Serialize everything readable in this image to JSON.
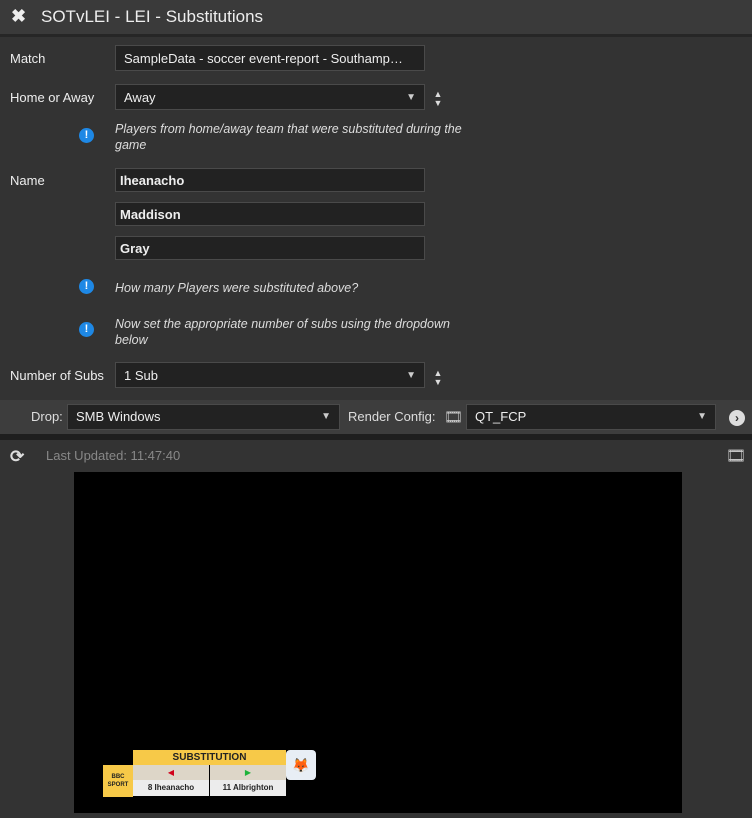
{
  "window": {
    "title": "SOTvLEI - LEI - Substitutions"
  },
  "form": {
    "match_label": "Match",
    "match_value": "SampleData - soccer event-report - Southamp…",
    "home_away_label": "Home or Away",
    "home_away_value": "Away",
    "note1": "Players from home/away team that were substituted during the game",
    "name_label": "Name",
    "names": [
      "Iheanacho",
      "Maddison",
      "Gray"
    ],
    "note2": "How many Players were substituted above?",
    "note3": "Now set the appropriate number of subs using the dropdown below",
    "subs_label": "Number of Subs",
    "subs_value": "1 Sub"
  },
  "toolbar": {
    "drop_label": "Drop:",
    "drop_value": "SMB Windows",
    "render_label": "Render Config:",
    "render_value": "QT_FCP"
  },
  "preview": {
    "last_updated": "Last Updated: 11:47:40",
    "graphic": {
      "header": "SUBSTITUTION",
      "logo_top": "BBC",
      "logo_bottom": "SPORT",
      "off": "8 Iheanacho",
      "on": "11 Albrighton"
    }
  },
  "colors": {
    "accent": "#1e88e5",
    "banner": "#f7c948",
    "off_arrow": "#d0021b",
    "on_arrow": "#1db33a"
  }
}
